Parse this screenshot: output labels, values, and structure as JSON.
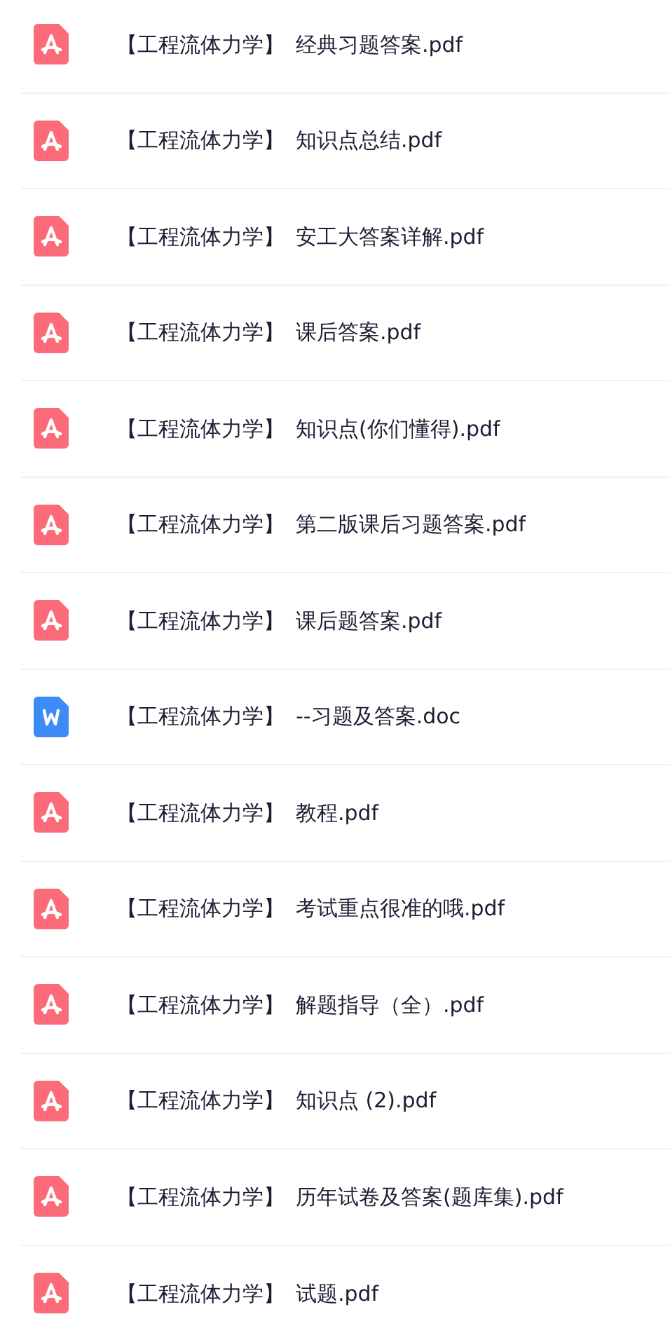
{
  "files": [
    {
      "kind": "pdf",
      "prefix": "【工程流体力学】",
      "name": "经典习题答案.pdf"
    },
    {
      "kind": "pdf",
      "prefix": "【工程流体力学】",
      "name": "知识点总结.pdf"
    },
    {
      "kind": "pdf",
      "prefix": "【工程流体力学】",
      "name": "安工大答案详解.pdf"
    },
    {
      "kind": "pdf",
      "prefix": "【工程流体力学】",
      "name": "课后答案.pdf"
    },
    {
      "kind": "pdf",
      "prefix": "【工程流体力学】",
      "name": "知识点(你们懂得).pdf"
    },
    {
      "kind": "pdf",
      "prefix": "【工程流体力学】",
      "name": "第二版课后习题答案.pdf"
    },
    {
      "kind": "pdf",
      "prefix": "【工程流体力学】",
      "name": "课后题答案.pdf"
    },
    {
      "kind": "doc",
      "prefix": "【工程流体力学】",
      "name": "--习题及答案.doc"
    },
    {
      "kind": "pdf",
      "prefix": "【工程流体力学】",
      "name": "教程.pdf"
    },
    {
      "kind": "pdf",
      "prefix": "【工程流体力学】",
      "name": "考试重点很准的哦.pdf"
    },
    {
      "kind": "pdf",
      "prefix": "【工程流体力学】",
      "name": "解题指导（全）.pdf"
    },
    {
      "kind": "pdf",
      "prefix": "【工程流体力学】",
      "name": "知识点 (2).pdf"
    },
    {
      "kind": "pdf",
      "prefix": "【工程流体力学】",
      "name": "历年试卷及答案(题库集).pdf"
    },
    {
      "kind": "pdf",
      "prefix": "【工程流体力学】",
      "name": "试题.pdf"
    }
  ]
}
